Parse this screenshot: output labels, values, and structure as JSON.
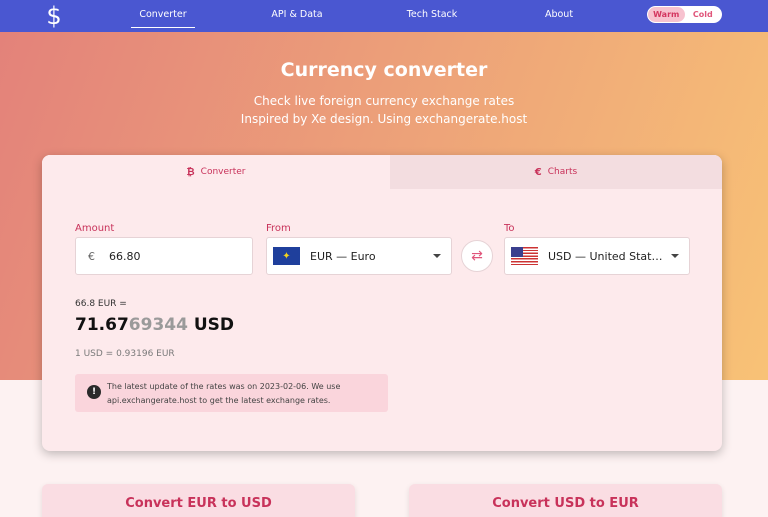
{
  "nav": {
    "logo_glyph": "$",
    "links": [
      "Converter",
      "API & Data",
      "Tech Stack",
      "About"
    ],
    "theme": {
      "warm": "Warm",
      "cold": "Cold",
      "selected": "Warm"
    }
  },
  "hero": {
    "title": "Currency converter",
    "subtitle_line1": "Check live foreign currency exchange rates",
    "subtitle_line2": "Inspired by Xe design. Using exchangerate.host"
  },
  "card": {
    "tabs": [
      {
        "label": "Converter",
        "icon": "bitcoin-icon",
        "glyph": "₿"
      },
      {
        "label": "Charts",
        "icon": "euro-icon",
        "glyph": "€"
      }
    ],
    "amount": {
      "label": "Amount",
      "currency_symbol": "€",
      "value": "66.80"
    },
    "from": {
      "label": "From",
      "value": "EUR — Euro"
    },
    "to": {
      "label": "To",
      "value": "USD — United States Dollar"
    },
    "swap_glyph": "⇄",
    "result": {
      "from_text": "66.8 EUR =",
      "amount_main": "71.67",
      "amount_dim": "69344",
      "currency": "USD",
      "rate": "1 USD = 0.93196 EUR"
    },
    "note": {
      "icon_glyph": "!",
      "line1": "The latest update of the rates was on 2023-02-06. We use",
      "line2": "api.exchangerate.host to get the latest exchange rates."
    }
  },
  "bottom": {
    "left_title": "Convert EUR to USD",
    "right_title": "Convert USD to EUR"
  },
  "colors": {
    "nav": "#4a57d1",
    "accent": "#c8325a"
  }
}
